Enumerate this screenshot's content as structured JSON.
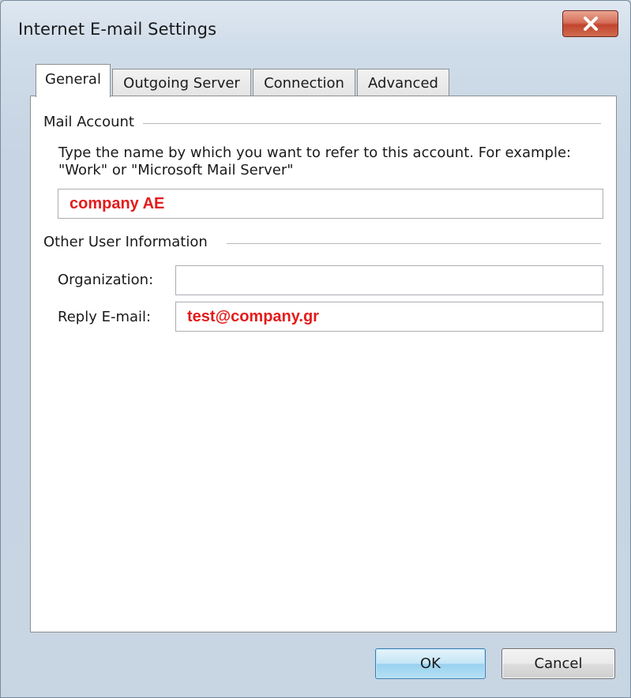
{
  "window": {
    "title": "Internet E-mail Settings",
    "close_icon": "close-icon"
  },
  "tabs": [
    {
      "label": "General",
      "active": true
    },
    {
      "label": "Outgoing Server",
      "active": false
    },
    {
      "label": "Connection",
      "active": false
    },
    {
      "label": "Advanced",
      "active": false
    }
  ],
  "mail_account": {
    "group_label": "Mail Account",
    "description": "Type the name by which you want to refer to this account. For example: \"Work\" or \"Microsoft Mail Server\"",
    "account_name_value": "company AE"
  },
  "other_user_info": {
    "group_label": "Other User Information",
    "organization_label": "Organization:",
    "organization_value": "",
    "reply_email_label": "Reply E-mail:",
    "reply_email_value": "test@company.gr"
  },
  "buttons": {
    "ok_label": "OK",
    "cancel_label": "Cancel"
  },
  "colors": {
    "annotation_text": "#e31b1b",
    "close_button": "#c2462f"
  }
}
